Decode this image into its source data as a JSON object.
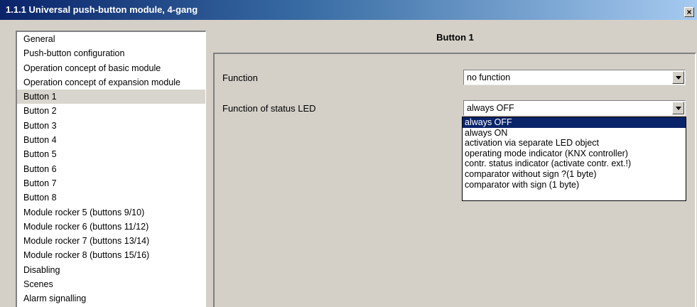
{
  "window": {
    "title": "1.1.1 Universal push-button module, 4-gang",
    "close_label": "×"
  },
  "nav": {
    "items": [
      "General",
      "Push-button configuration",
      "Operation concept of basic module",
      "Operation concept of expansion module",
      "Button 1",
      "Button 2",
      "Button 3",
      "Button 4",
      "Button 5",
      "Button 6",
      "Button 7",
      "Button 8",
      "Module rocker 5 (buttons 9/10)",
      "Module rocker 6 (buttons 11/12)",
      "Module rocker 7 (buttons 13/14)",
      "Module rocker 8 (buttons 15/16)",
      "Disabling",
      "Scenes",
      "Alarm signalling"
    ],
    "selected_index": 4
  },
  "panel": {
    "title": "Button 1",
    "function_label": "Function",
    "function_value": "no function",
    "led_label": "Function of status LED",
    "led_value": "always OFF",
    "led_options": [
      "always OFF",
      "always ON",
      "activation via separate LED object",
      "operating mode indicator (KNX controller)",
      "contr. status indicator (activate contr. ext.!)",
      "comparator without sign ?(1 byte)",
      "comparator with sign (1 byte)"
    ],
    "highlighted_option_index": 0
  },
  "colors": {
    "titlebar_start": "#0a246a",
    "titlebar_end": "#a6caf0",
    "face": "#d4d0c8",
    "highlight": "#0a246a"
  }
}
